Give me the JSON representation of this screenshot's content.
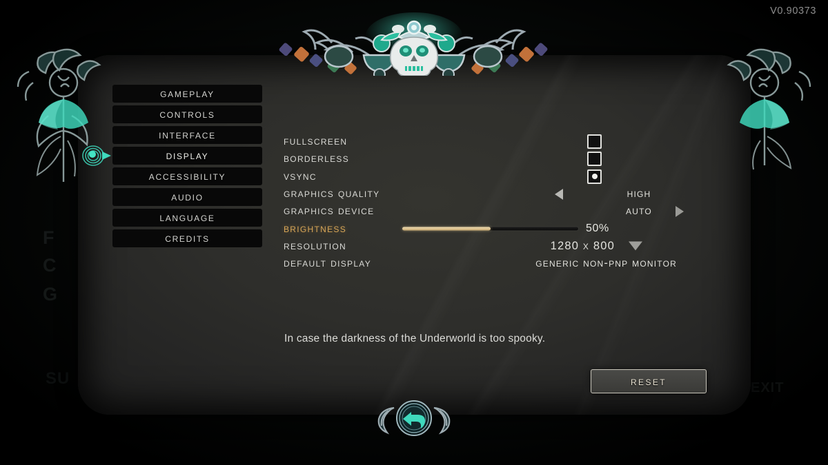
{
  "version": "V0.90373",
  "background_words": [
    "F",
    "C",
    "G",
    "SU",
    "EXIT"
  ],
  "ornaments": {
    "top": "skull-ornament",
    "left": "bow-crescent-ornament",
    "right": "bow-crescent-ornament",
    "cursor": "teal-selection-cursor",
    "back": "back-arrow-icon"
  },
  "colors": {
    "accent_gold": "#d8a657",
    "teal": "#3fd9bd",
    "panel": "#2f2f2c",
    "text": "#dadad6"
  },
  "sidebar": {
    "items": [
      {
        "label": "Gameplay",
        "selected": false
      },
      {
        "label": "Controls",
        "selected": false
      },
      {
        "label": "Interface",
        "selected": false
      },
      {
        "label": "Display",
        "selected": true
      },
      {
        "label": "Accessibility",
        "selected": false
      },
      {
        "label": "Audio",
        "selected": false
      },
      {
        "label": "Language",
        "selected": false
      },
      {
        "label": "Credits",
        "selected": false
      }
    ]
  },
  "settings": {
    "rows": [
      {
        "label": "Fullscreen",
        "type": "checkbox",
        "checked": false,
        "highlight": false
      },
      {
        "label": "Borderless",
        "type": "checkbox",
        "checked": false,
        "highlight": false
      },
      {
        "label": "VSync",
        "type": "checkbox",
        "checked": true,
        "highlight": false
      },
      {
        "label": "Graphics Quality",
        "type": "selector",
        "value": "High",
        "left_arrow": true,
        "right_arrow": false,
        "highlight": false
      },
      {
        "label": "Graphics Device",
        "type": "selector",
        "value": "Auto",
        "left_arrow": false,
        "right_arrow": true,
        "highlight": false
      },
      {
        "label": "Brightness",
        "type": "slider",
        "value": "50%",
        "percent": 50,
        "highlight": true
      },
      {
        "label": "Resolution",
        "type": "dropdown",
        "value": "1280 x 800",
        "highlight": false
      },
      {
        "label": "Default Display",
        "type": "text",
        "value": "Generic Non-PnP Monitor",
        "highlight": false
      }
    ]
  },
  "description": "In case the darkness of the Underworld is too spooky.",
  "reset": {
    "label": "Reset"
  }
}
